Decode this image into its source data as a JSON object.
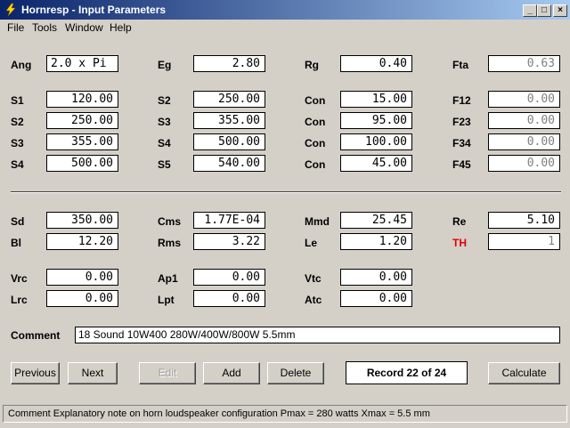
{
  "window": {
    "title": "Hornresp - Input Parameters",
    "minimize": "_",
    "maximize": "□",
    "close": "×"
  },
  "menu": {
    "file": "File",
    "tools": "Tools",
    "window": "Window",
    "help": "Help"
  },
  "params": {
    "ang": {
      "label": "Ang",
      "value": "2.0 x Pi"
    },
    "eg": {
      "label": "Eg",
      "value": "2.80"
    },
    "rg": {
      "label": "Rg",
      "value": "0.40"
    },
    "fta": {
      "label": "Fta",
      "value": "0.63"
    },
    "s1": {
      "label": "S1",
      "value": "120.00"
    },
    "s2": {
      "label": "S2",
      "value": "250.00"
    },
    "s2b": {
      "label": "S2",
      "value": "250.00"
    },
    "s3": {
      "label": "S3",
      "value": "355.00"
    },
    "s3b": {
      "label": "S3",
      "value": "355.00"
    },
    "s4": {
      "label": "S4",
      "value": "500.00"
    },
    "s4b": {
      "label": "S4",
      "value": "500.00"
    },
    "s5": {
      "label": "S5",
      "value": "540.00"
    },
    "con1": {
      "label": "Con",
      "value": "15.00"
    },
    "con2": {
      "label": "Con",
      "value": "95.00"
    },
    "con3": {
      "label": "Con",
      "value": "100.00"
    },
    "con4": {
      "label": "Con",
      "value": "45.00"
    },
    "f12": {
      "label": "F12",
      "value": "0.00"
    },
    "f23": {
      "label": "F23",
      "value": "0.00"
    },
    "f34": {
      "label": "F34",
      "value": "0.00"
    },
    "f45": {
      "label": "F45",
      "value": "0.00"
    },
    "sd": {
      "label": "Sd",
      "value": "350.00"
    },
    "cms": {
      "label": "Cms",
      "value": "1.77E-04"
    },
    "mmd": {
      "label": "Mmd",
      "value": "25.45"
    },
    "re": {
      "label": "Re",
      "value": "5.10"
    },
    "bl": {
      "label": "Bl",
      "value": "12.20"
    },
    "rms": {
      "label": "Rms",
      "value": "3.22"
    },
    "le": {
      "label": "Le",
      "value": "1.20"
    },
    "th": {
      "label": "TH",
      "value": "1"
    },
    "vrc": {
      "label": "Vrc",
      "value": "0.00"
    },
    "ap1": {
      "label": "Ap1",
      "value": "0.00"
    },
    "vtc": {
      "label": "Vtc",
      "value": "0.00"
    },
    "lrc": {
      "label": "Lrc",
      "value": "0.00"
    },
    "lpt": {
      "label": "Lpt",
      "value": "0.00"
    },
    "atc": {
      "label": "Atc",
      "value": "0.00"
    }
  },
  "comment": {
    "label": "Comment",
    "value": "18 Sound 10W400  280W/400W/800W 5.5mm"
  },
  "buttons": {
    "previous": "Previous",
    "next": "Next",
    "edit": "Edit",
    "add": "Add",
    "delete": "Delete",
    "calculate": "Calculate"
  },
  "record": "Record 22 of 24",
  "status": "Comment   Explanatory note on horn loudspeaker configuration   Pmax = 280 watts   Xmax = 5.5 mm",
  "colors": {
    "th_label": "#e00000",
    "title_bar_start": "#0a246a",
    "title_bar_end": "#a6caf0"
  }
}
